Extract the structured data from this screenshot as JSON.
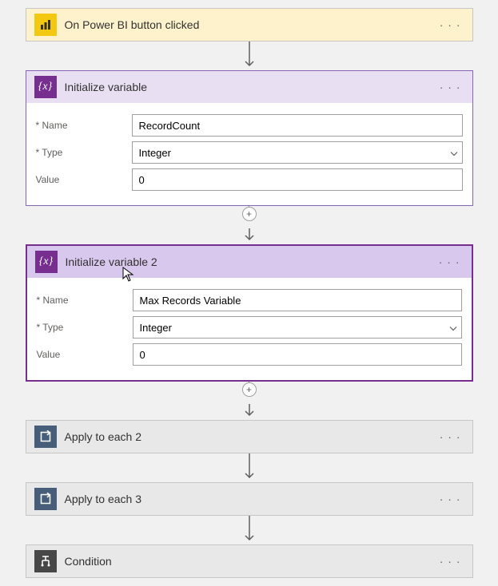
{
  "trigger": {
    "title": "On Power BI button clicked"
  },
  "var1": {
    "title": "Initialize variable",
    "name_label": "Name",
    "type_label": "Type",
    "value_label": "Value",
    "name_value": "RecordCount",
    "type_value": "Integer",
    "value_value": "0"
  },
  "var2": {
    "title": "Initialize variable 2",
    "name_label": "Name",
    "type_label": "Type",
    "value_label": "Value",
    "name_value": "Max Records Variable",
    "type_value": "Integer",
    "value_value": "0"
  },
  "loop2": {
    "title": "Apply to each 2"
  },
  "loop3": {
    "title": "Apply to each 3"
  },
  "condition": {
    "title": "Condition"
  },
  "icons": {
    "var": "{x}",
    "plus": "+"
  }
}
